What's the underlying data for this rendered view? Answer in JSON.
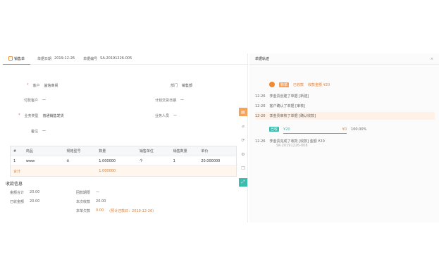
{
  "tab": {
    "label": "销售单"
  },
  "header_meta": {
    "date_label": "单据日期",
    "date": "2019-12-26",
    "no_label": "单据编号",
    "no": "SA-20191226-005"
  },
  "form": {
    "customer_label": "客户",
    "customer": "益信商贸",
    "payer_label": "付款客户",
    "payer": "—",
    "biz_type_label": "业务类型",
    "biz_type": "普通销售发货",
    "note_label": "备注",
    "note": "—",
    "dept_label": "部门",
    "dept": "销售部",
    "plan_date_label": "计划交货日期",
    "plan_date": "—",
    "handler_label": "业务人员",
    "handler": "—"
  },
  "table": {
    "headers": [
      "#",
      "商品",
      "规格型号",
      "数量",
      "销售单位",
      "销售数量",
      "单价"
    ],
    "rows": [
      [
        "1",
        "www",
        "ti",
        "1.000000",
        "个",
        "1",
        "20.000000"
      ]
    ],
    "summary": [
      "合计",
      "",
      "",
      "1.000000",
      "",
      "",
      ""
    ]
  },
  "settlement": {
    "title": "收款信息",
    "amount_label": "金额合计",
    "amount": "20.00",
    "received_label": "已收金额",
    "received": "20.00",
    "owner_label": "回款期限",
    "owner": "—",
    "debt_label": "本次收款",
    "debt": "20.00",
    "due_label": "本单欠款",
    "due": "0.00",
    "due_note": "(预计还款日：2019-12-26)"
  },
  "toolstrip": {
    "icons": [
      "document-icon",
      "attach-icon",
      "share-icon",
      "settings-icon",
      "copy-icon",
      "expand-icon"
    ]
  },
  "right": {
    "title": "单据轨迹",
    "close": "×",
    "top_tags": [
      "转单",
      "已收款",
      "收款金额 ¥20"
    ],
    "events": [
      {
        "time": "12-26",
        "text": "李金贵创建了单据 [新建]"
      },
      {
        "time": "12-26",
        "text": "客户确认了单据 [审核]"
      },
      {
        "time": "12-26",
        "text": "李金贵审核了单据 [确认收款]"
      }
    ],
    "status_tag": "已收",
    "progress_text": "¥20",
    "progress_right": "¥0",
    "progress_pct": "100.00%",
    "last_event_time": "12-26",
    "last_event_text": "李金贵完成了收款 [收款] 金额 ¥20",
    "last_event_sub": "SK-20191226-008"
  },
  "colors": {
    "accent": "#f08a33",
    "teal": "#3cbcae"
  }
}
